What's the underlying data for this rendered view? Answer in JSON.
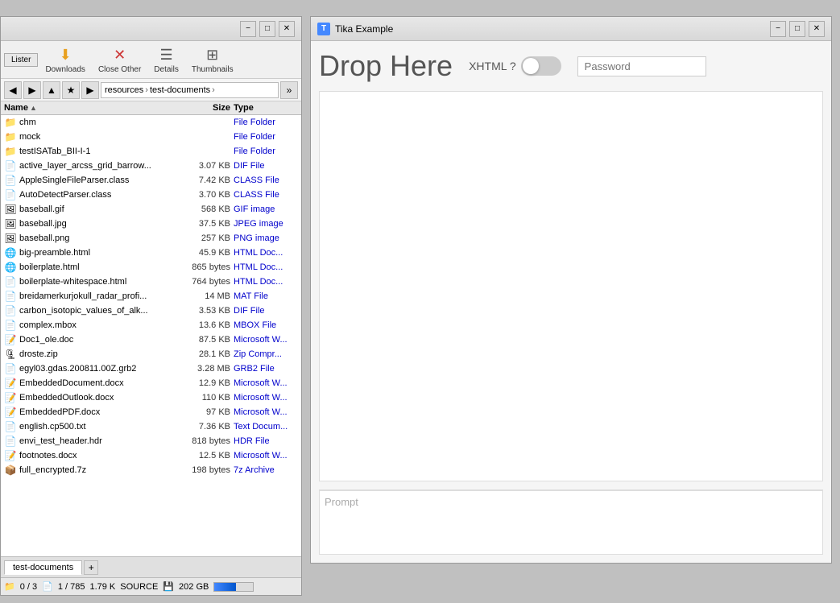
{
  "fileManager": {
    "toolbar": {
      "lister_label": "Lister",
      "downloads_label": "Downloads",
      "close_other_label": "Close Other",
      "details_label": "Details",
      "thumbnails_label": "Thumbnails"
    },
    "breadcrumb": {
      "parts": [
        "resources",
        "test-documents"
      ]
    },
    "columns": {
      "name": "Name",
      "size": "Size",
      "type": "Type"
    },
    "files": [
      {
        "name": "chm",
        "size": "",
        "type": "File Folder",
        "icon": "folder"
      },
      {
        "name": "mock",
        "size": "",
        "type": "File Folder",
        "icon": "folder"
      },
      {
        "name": "testISATab_BII-I-1",
        "size": "",
        "type": "File Folder",
        "icon": "folder"
      },
      {
        "name": "active_layer_arcss_grid_barrow...",
        "size": "3.07 KB",
        "type": "DIF File",
        "icon": "file"
      },
      {
        "name": "AppleSingleFileParser.class",
        "size": "7.42 KB",
        "type": "CLASS File",
        "icon": "file"
      },
      {
        "name": "AutoDetectParser.class",
        "size": "3.70 KB",
        "type": "CLASS File",
        "icon": "file"
      },
      {
        "name": "baseball.gif",
        "size": "568 KB",
        "type": "GIF image",
        "icon": "gif"
      },
      {
        "name": "baseball.jpg",
        "size": "37.5 KB",
        "type": "JPEG image",
        "icon": "jpg"
      },
      {
        "name": "baseball.png",
        "size": "257 KB",
        "type": "PNG image",
        "icon": "png"
      },
      {
        "name": "big-preamble.html",
        "size": "45.9 KB",
        "type": "HTML Doc...",
        "icon": "html"
      },
      {
        "name": "boilerplate.html",
        "size": "865 bytes",
        "type": "HTML Doc...",
        "icon": "html"
      },
      {
        "name": "boilerplate-whitespace.html",
        "size": "764 bytes",
        "type": "HTML Doc...",
        "icon": "file"
      },
      {
        "name": "breidamerkurjokull_radar_profi...",
        "size": "14 MB",
        "type": "MAT File",
        "icon": "file"
      },
      {
        "name": "carbon_isotopic_values_of_alk...",
        "size": "3.53 KB",
        "type": "DIF File",
        "icon": "file"
      },
      {
        "name": "complex.mbox",
        "size": "13.6 KB",
        "type": "MBOX File",
        "icon": "file"
      },
      {
        "name": "Doc1_ole.doc",
        "size": "87.5 KB",
        "type": "Microsoft W...",
        "icon": "doc"
      },
      {
        "name": "droste.zip",
        "size": "28.1 KB",
        "type": "Zip Compr...",
        "icon": "zip"
      },
      {
        "name": "egyl03.gdas.200811.00Z.grb2",
        "size": "3.28 MB",
        "type": "GRB2 File",
        "icon": "file"
      },
      {
        "name": "EmbeddedDocument.docx",
        "size": "12.9 KB",
        "type": "Microsoft W...",
        "icon": "docx"
      },
      {
        "name": "EmbeddedOutlook.docx",
        "size": "110 KB",
        "type": "Microsoft W...",
        "icon": "docx"
      },
      {
        "name": "EmbeddedPDF.docx",
        "size": "97 KB",
        "type": "Microsoft W...",
        "icon": "docx"
      },
      {
        "name": "english.cp500.txt",
        "size": "7.36 KB",
        "type": "Text Docum...",
        "icon": "txt"
      },
      {
        "name": "envi_test_header.hdr",
        "size": "818 bytes",
        "type": "HDR File",
        "icon": "file"
      },
      {
        "name": "footnotes.docx",
        "size": "12.5 KB",
        "type": "Microsoft W...",
        "icon": "docx"
      },
      {
        "name": "full_encrypted.7z",
        "size": "198 bytes",
        "type": "7z Archive",
        "icon": "archive"
      }
    ],
    "tabs": [
      {
        "label": "test-documents",
        "active": true
      }
    ],
    "status": {
      "folders": "0 / 3",
      "files": "1 / 785",
      "size": "1.79 K",
      "source_label": "SOURCE",
      "disk_size": "202 GB"
    }
  },
  "tika": {
    "title": "Tika Example",
    "drop_here": "Drop Here",
    "xhtml_label": "XHTML ?",
    "password_placeholder": "Password",
    "prompt_placeholder": "Prompt",
    "window_buttons": {
      "minimize": "−",
      "maximize": "□",
      "close": "✕"
    }
  },
  "icons": {
    "folder": "📁",
    "file": "📄",
    "gif": "🖼",
    "jpg": "🖼",
    "png": "🖼",
    "html": "🌐",
    "doc": "📝",
    "docx": "📝",
    "zip": "🗜",
    "txt": "📄",
    "archive": "📦"
  }
}
